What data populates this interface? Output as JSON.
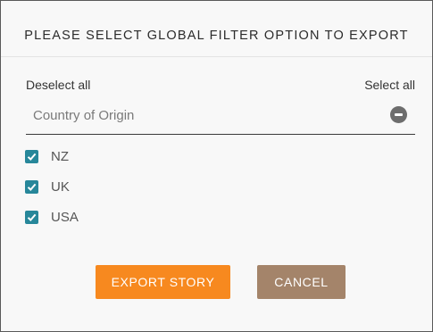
{
  "dialog": {
    "title": "PLEASE SELECT GLOBAL FILTER OPTION TO EXPORT",
    "deselect_all": "Deselect all",
    "select_all": "Select all",
    "filter_field": {
      "label": "Country of Origin",
      "icon": "remove-circle-icon"
    },
    "options": [
      {
        "label": "NZ",
        "checked": true
      },
      {
        "label": "UK",
        "checked": true
      },
      {
        "label": "USA",
        "checked": true
      }
    ],
    "buttons": {
      "export": "EXPORT STORY",
      "cancel": "CANCEL"
    },
    "colors": {
      "checkbox": "#27879a",
      "export_button": "#f7891f",
      "cancel_button": "#a4846a"
    }
  }
}
